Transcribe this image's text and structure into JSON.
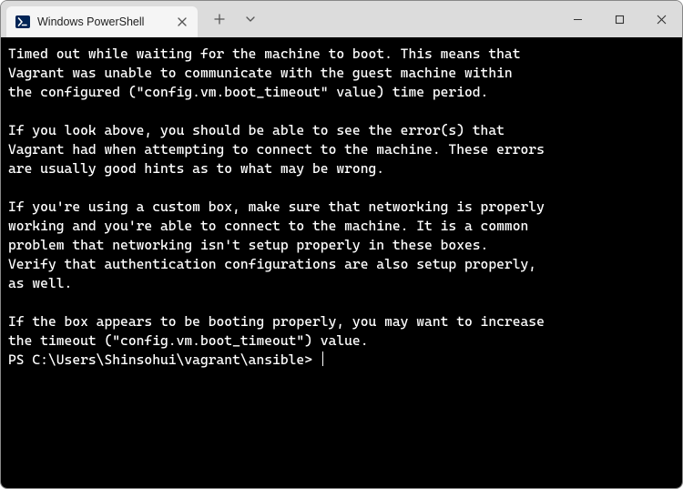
{
  "window": {
    "tab_title": "Windows PowerShell"
  },
  "terminal": {
    "lines": [
      "Timed out while waiting for the machine to boot. This means that",
      "Vagrant was unable to communicate with the guest machine within",
      "the configured (\"config.vm.boot_timeout\" value) time period.",
      "",
      "If you look above, you should be able to see the error(s) that",
      "Vagrant had when attempting to connect to the machine. These errors",
      "are usually good hints as to what may be wrong.",
      "",
      "If you're using a custom box, make sure that networking is properly",
      "working and you're able to connect to the machine. It is a common",
      "problem that networking isn't setup properly in these boxes.",
      "Verify that authentication configurations are also setup properly,",
      "as well.",
      "",
      "If the box appears to be booting properly, you may want to increase",
      "the timeout (\"config.vm.boot_timeout\") value."
    ],
    "prompt": "PS C:\\Users\\Shinsohui\\vagrant\\ansible> "
  }
}
